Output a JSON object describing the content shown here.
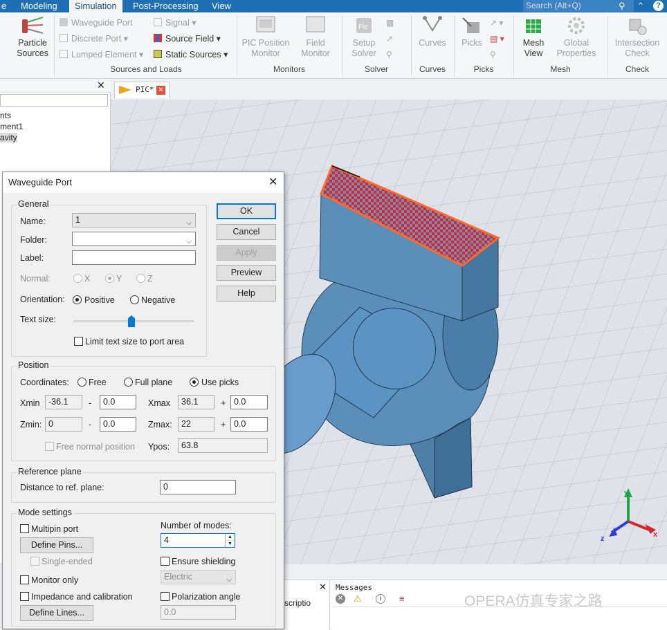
{
  "menu": {
    "items": [
      "e",
      "Modeling",
      "Simulation",
      "Post-Processing",
      "View"
    ],
    "active": "Simulation",
    "search_placeholder": "Search (Alt+Q)"
  },
  "ribbon": {
    "particle_sources": "Particle\nSources",
    "waveguide_port": "Waveguide Port",
    "discrete_port": "Discrete Port",
    "lumped_element": "Lumped Element",
    "signal": "Signal",
    "source_field": "Source Field",
    "static_sources": "Static Sources",
    "group_sources": "Sources and Loads",
    "pic_position_monitor": "PIC Position\nMonitor",
    "field_monitor": "Field\nMonitor",
    "group_monitors": "Monitors",
    "setup_solver": "Setup\nSolver",
    "group_solver": "Solver",
    "curves": "Curves",
    "group_curves": "Curves",
    "picks": "Picks",
    "group_picks": "Picks",
    "mesh_view": "Mesh\nView",
    "global_properties": "Global\nProperties",
    "group_mesh": "Mesh",
    "intersection_check": "Intersection\nCheck",
    "group_check": "Check"
  },
  "tree": {
    "items": [
      "nts",
      "ment1",
      "avity"
    ]
  },
  "tab": {
    "label": "PIC*"
  },
  "dialog": {
    "title": "Waveguide Port",
    "general_legend": "General",
    "name_label": "Name:",
    "name_value": "1",
    "folder_label": "Folder:",
    "folder_value": "",
    "label_label": "Label:",
    "label_value": "",
    "normal_label": "Normal:",
    "normal_x": "X",
    "normal_y": "Y",
    "normal_z": "Z",
    "orientation_label": "Orientation:",
    "orientation_positive": "Positive",
    "orientation_negative": "Negative",
    "text_size_label": "Text size:",
    "text_size_fraction": 0.48,
    "limit_text_label": "Limit text size to port area",
    "position_legend": "Position",
    "coordinates_label": "Coordinates:",
    "coord_free": "Free",
    "coord_full_plane": "Full plane",
    "coord_use_picks": "Use picks",
    "xmin_label": "Xmin",
    "xmin_value": "-36.1",
    "xmin_offset": "0.0",
    "xmax_label": "Xmax",
    "xmax_value": "36.1",
    "xmax_offset": "0.0",
    "zmin_label": "Zmin:",
    "zmin_value": "0",
    "zmin_offset": "0.0",
    "zmax_label": "Zmax:",
    "zmax_value": "22",
    "zmax_offset": "0.0",
    "minus": "-",
    "plus": "+",
    "free_normal_label": "Free normal position",
    "ypos_label": "Ypos:",
    "ypos_value": "63.8",
    "ref_legend": "Reference plane",
    "distance_label": "Distance to ref. plane:",
    "distance_value": "0",
    "mode_legend": "Mode settings",
    "multipin_label": "Multipin port",
    "define_pins": "Define Pins...",
    "single_ended": "Single-ended",
    "monitor_only": "Monitor only",
    "impedance_label": "Impedance and calibration",
    "define_lines": "Define Lines...",
    "num_modes_label": "Number of modes:",
    "num_modes_value": "4",
    "ensure_shielding": "Ensure shielding",
    "electric_value": "Electric",
    "polarization_label": "Polarization angle",
    "polarization_value": "0.0",
    "ok": "OK",
    "cancel": "Cancel",
    "apply": "Apply",
    "preview": "Preview",
    "help": "Help"
  },
  "bottom": {
    "description_label": "scriptio",
    "messages_title": "Messages",
    "watermark": "OPERA仿真专家之路"
  },
  "axes": {
    "x": "x",
    "y": "y",
    "z": "z"
  },
  "colors": {
    "accent": "#1f6fb5",
    "model": "#5b8fba",
    "port_outline": "#ff6a2a",
    "port_dots": "#e0202a"
  }
}
